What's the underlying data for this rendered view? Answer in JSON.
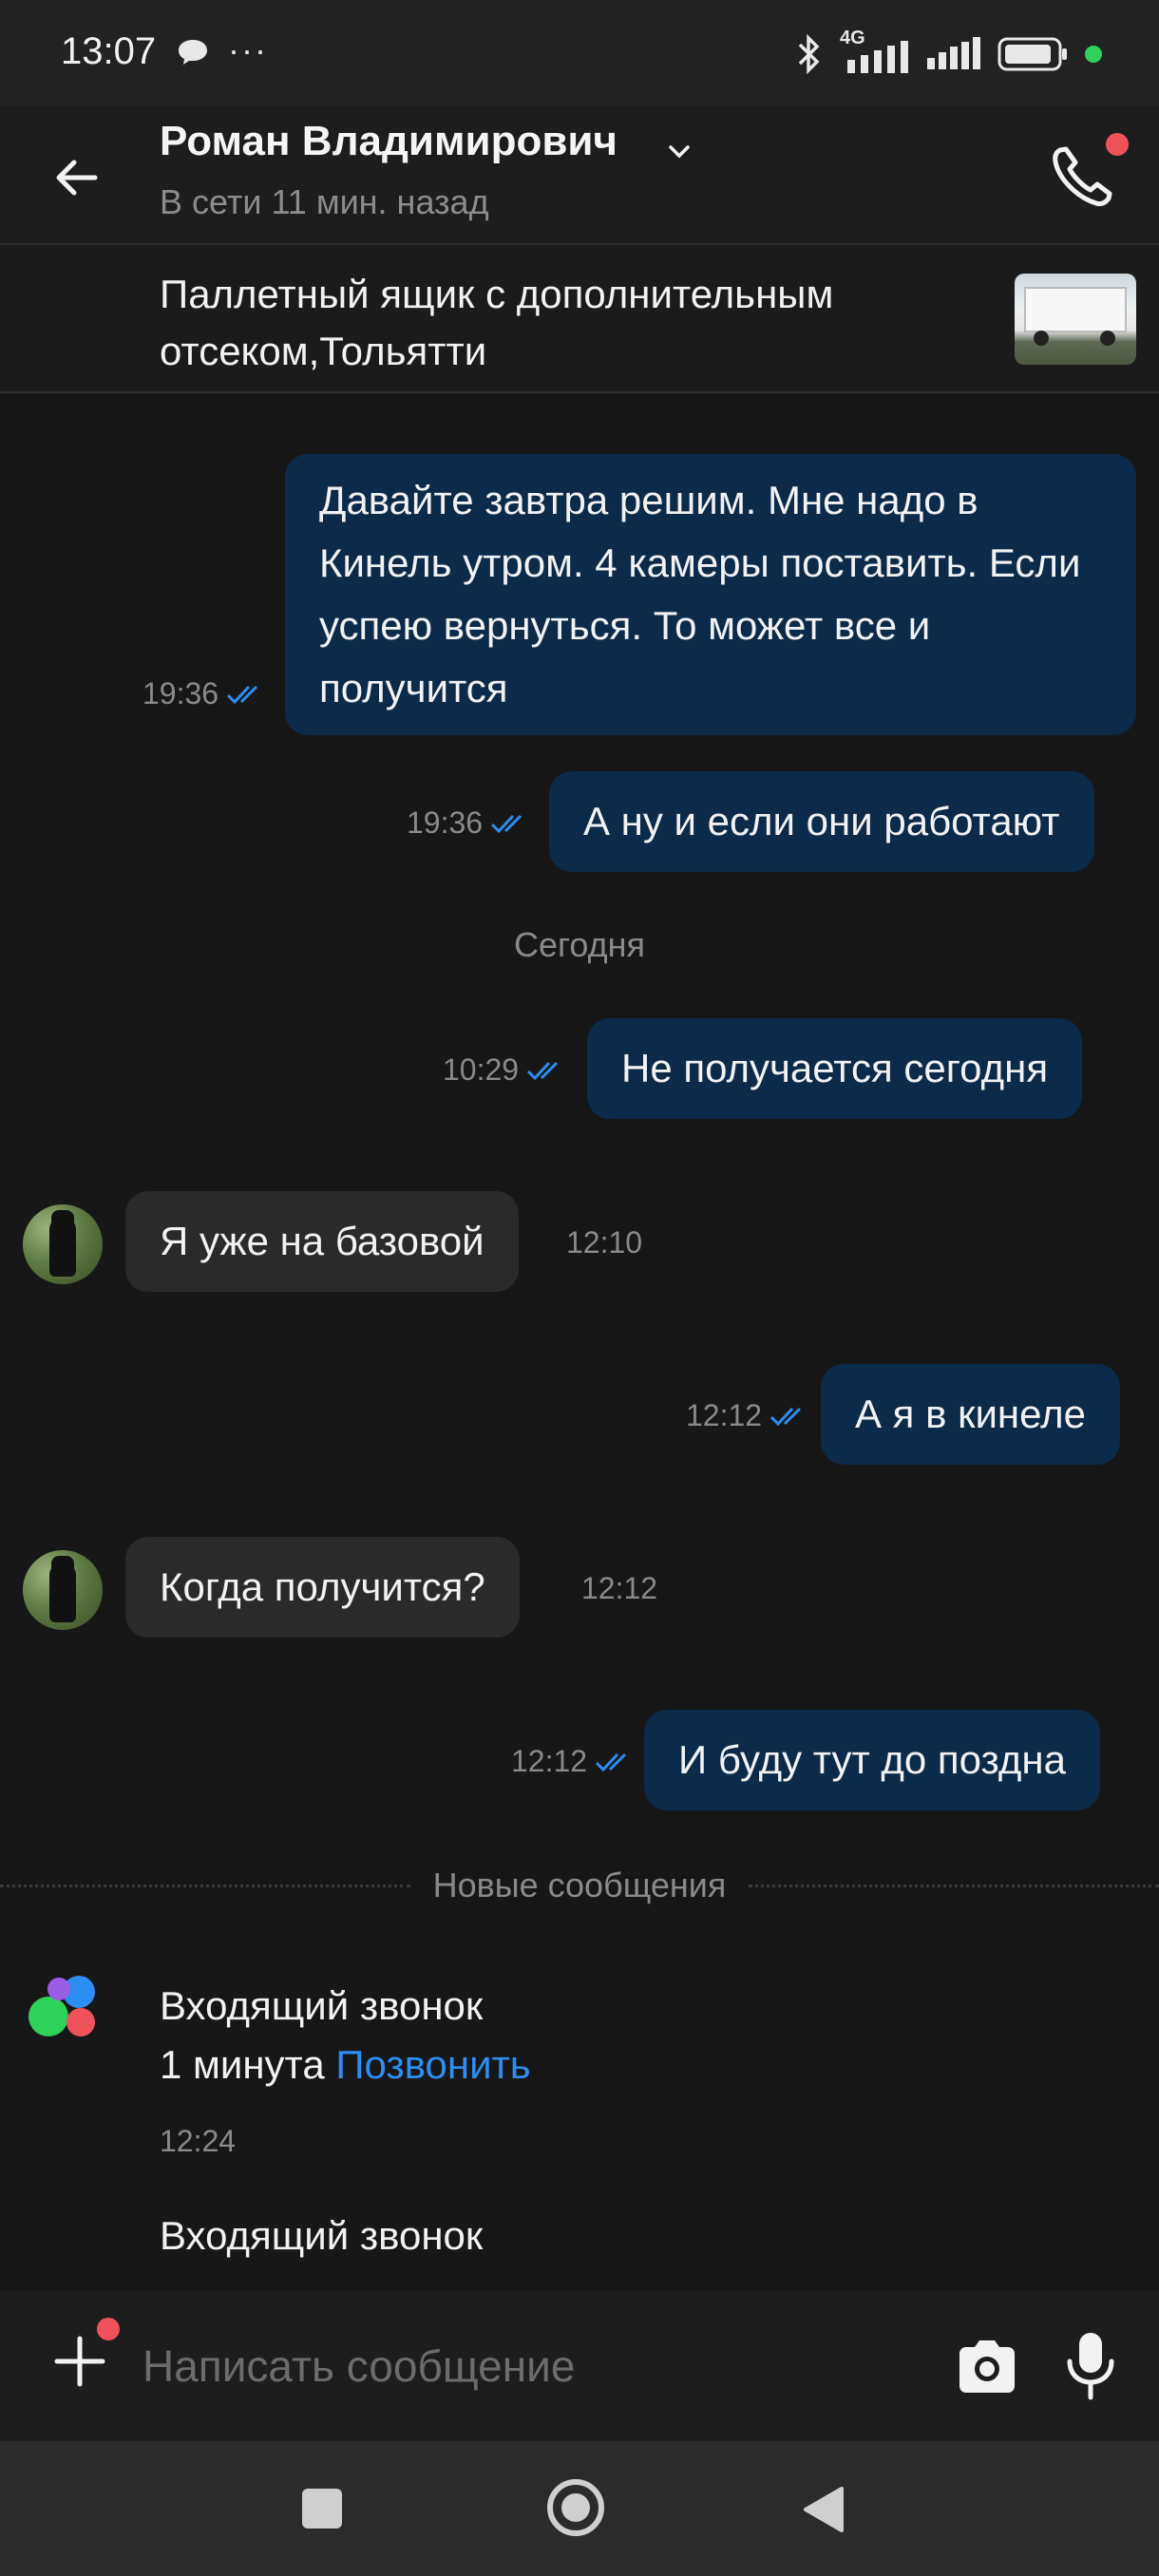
{
  "status_bar": {
    "time": "13:07",
    "dots": "···",
    "network": "4G"
  },
  "header": {
    "contact_name": "Роман Владимирович",
    "status": "В сети 11 мин. назад"
  },
  "listing": {
    "title": "Паллетный ящик с дополнительным отсеком,Тольятти"
  },
  "messages": [
    {
      "dir": "out",
      "text": "Давайте завтра решим. Мне надо в Кинель утром. 4 камеры поставить. Если успею вернуться. То может все и получится",
      "time": "19:36"
    },
    {
      "dir": "out",
      "text": "А ну и если они работают",
      "time": "19:36"
    },
    {
      "dir": "separator",
      "text": "Сегодня"
    },
    {
      "dir": "out",
      "text": "Не получается сегодня",
      "time": "10:29"
    },
    {
      "dir": "in",
      "text": "Я уже на базовой",
      "time": "12:10"
    },
    {
      "dir": "out",
      "text": "А я в кинеле",
      "time": "12:12"
    },
    {
      "dir": "in",
      "text": "Когда получится?",
      "time": "12:12"
    },
    {
      "dir": "out",
      "text": "И буду тут до поздна",
      "time": "12:12"
    }
  ],
  "new_messages_label": "Новые сообщения",
  "calls": [
    {
      "title": "Входящий звонок",
      "duration": "1 минута",
      "action": "Позвонить",
      "time": "12:24"
    },
    {
      "title": "Входящий звонок"
    }
  ],
  "input": {
    "placeholder": "Написать сообщение"
  },
  "colors": {
    "outgoing_bubble": "#0c2a4a",
    "incoming_bubble": "#2a2a2a",
    "link": "#2d8df0",
    "badge": "#f0525b",
    "online_dot": "#2fd15b"
  },
  "icons": [
    "chat-bubble-icon",
    "bluetooth-icon",
    "signal-icon",
    "battery-icon",
    "back-arrow-icon",
    "chevron-down-icon",
    "phone-icon",
    "read-ticks-icon",
    "plus-icon",
    "camera-icon",
    "microphone-icon",
    "nav-recent-icon",
    "nav-home-icon",
    "nav-back-icon"
  ]
}
